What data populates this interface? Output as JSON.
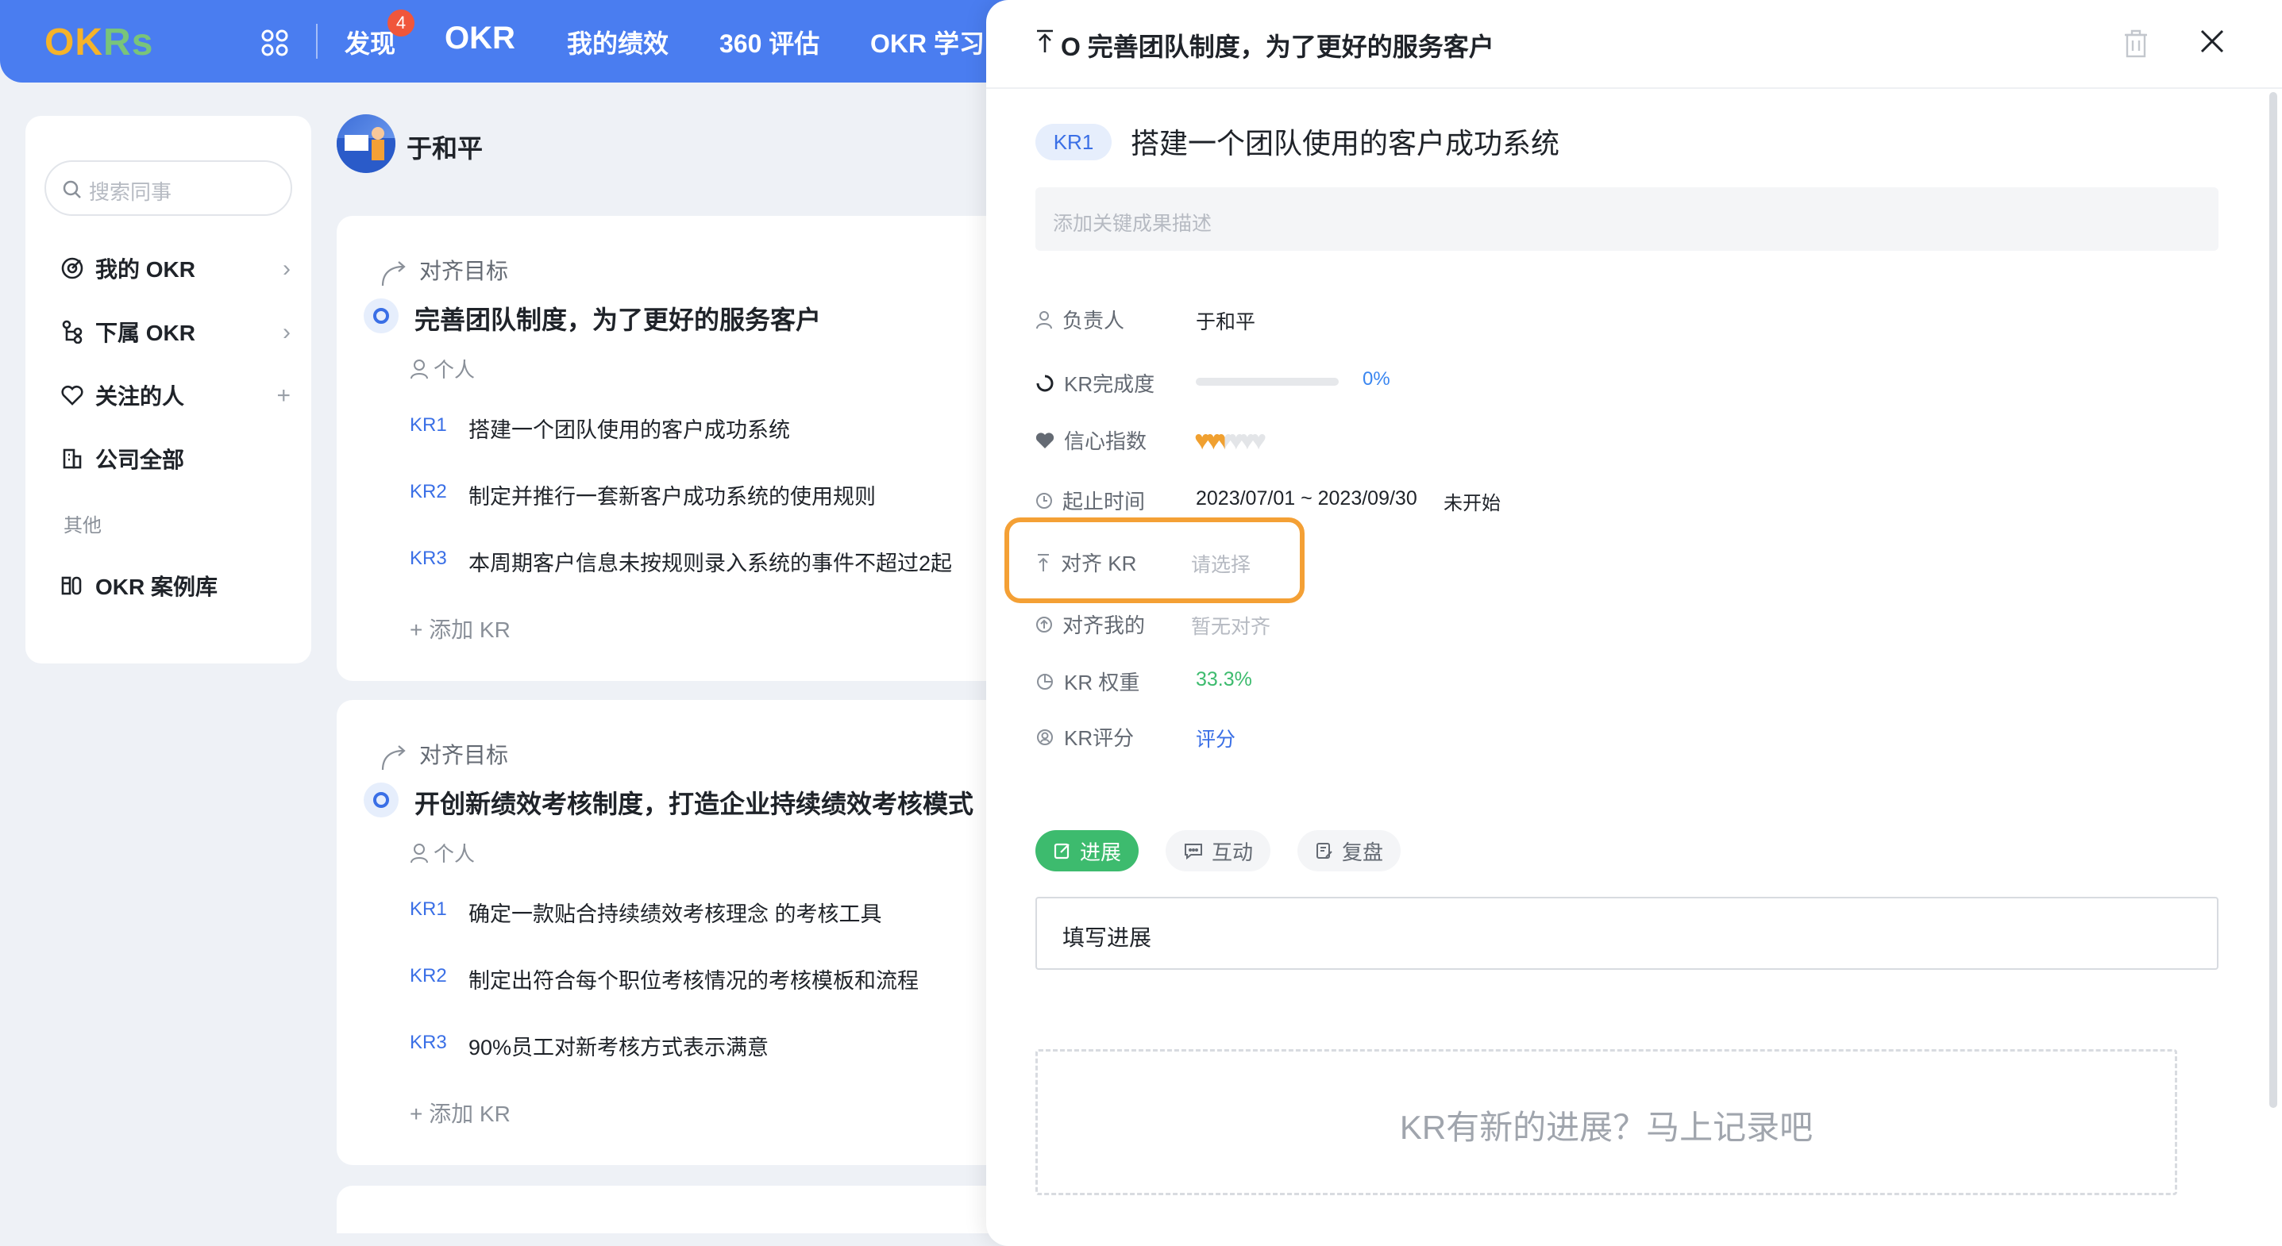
{
  "app": {
    "logo": "OKRs",
    "nav": {
      "discover": "发现",
      "discover_badge": "4",
      "okr": "OKR",
      "my_performance": "我的绩效",
      "review_360": "360 评估",
      "okr_learn": "OKR 学习"
    }
  },
  "sidebar": {
    "search_placeholder": "搜索同事",
    "items": [
      {
        "label": "我的 OKR",
        "icon": "target-icon"
      },
      {
        "label": "下属 OKR",
        "icon": "org-tree-icon"
      },
      {
        "label": "关注的人",
        "icon": "heart-outline-icon"
      },
      {
        "label": "公司全部",
        "icon": "building-icon"
      }
    ],
    "other_label": "其他",
    "library": "OKR 案例库"
  },
  "profile": {
    "name": "于和平"
  },
  "objectives": [
    {
      "align_label": "对齐目标",
      "title": "完善团队制度，为了更好的服务客户",
      "owner": "个人",
      "krs": [
        {
          "tag": "KR1",
          "text": "搭建一个团队使用的客户成功系统"
        },
        {
          "tag": "KR2",
          "text": "制定并推行一套新客户成功系统的使用规则"
        },
        {
          "tag": "KR3",
          "text": "本周期客户信息未按规则录入系统的事件不超过2起"
        }
      ],
      "add_kr": "+ 添加 KR"
    },
    {
      "align_label": "对齐目标",
      "title": "开创新绩效考核制度，打造企业持续绩效考核模式",
      "owner": "个人",
      "krs": [
        {
          "tag": "KR1",
          "text": "确定一款贴合持续绩效考核理念 的考核工具"
        },
        {
          "tag": "KR2",
          "text": "制定出符合每个职位考核情况的考核模板和流程"
        },
        {
          "tag": "KR3",
          "text": "90%员工对新考核方式表示满意"
        }
      ],
      "add_kr": "+ 添加 KR"
    }
  ],
  "drawer": {
    "header_title": "O 完善团队制度，为了更好的服务客户",
    "kr_chip": "KR1",
    "kr_title": "搭建一个团队使用的客户成功系统",
    "desc_placeholder": "添加关键成果描述",
    "fields": {
      "owner_label": "负责人",
      "owner_value": "于和平",
      "progress_label": "KR完成度",
      "progress_value": "0%",
      "progress_fraction": 0,
      "confidence_label": "信心指数",
      "confidence_level": 2.5,
      "confidence_max": 6,
      "time_label": "起止时间",
      "time_value": "2023/07/01 ~ 2023/09/30",
      "time_status": "未开始",
      "align_kr_label": "对齐 KR",
      "align_kr_value": "请选择",
      "align_mine_label": "对齐我的",
      "align_mine_value": "暂无对齐",
      "weight_label": "KR 权重",
      "weight_value": "33.3%",
      "score_label": "KR评分",
      "score_value": "评分"
    },
    "tabs": [
      {
        "label": "进展",
        "active": true
      },
      {
        "label": "互动",
        "active": false
      },
      {
        "label": "复盘",
        "active": false
      }
    ],
    "input_placeholder": "填写进展",
    "empty_hint": "KR有新的进展？马上记录吧"
  },
  "colors": {
    "primary": "#4a7df0",
    "accent_green": "#3dbb6e",
    "highlight_orange": "#f4a035",
    "heart_orange": "#f0a030",
    "link_blue": "#3a6fe6"
  }
}
